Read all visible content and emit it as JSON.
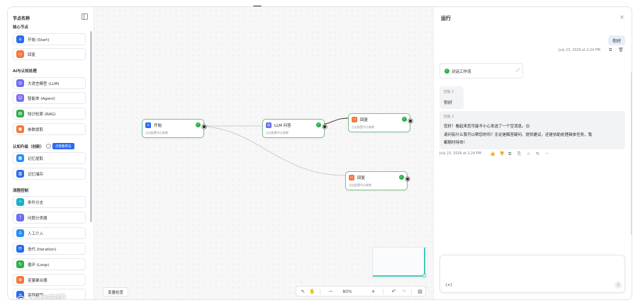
{
  "sidebar": {
    "title": "节点名称",
    "groups": {
      "core": "核心节点",
      "ai": "AI与认知处理",
      "cognitive": "认知升级（创新）",
      "flow": "流程控制"
    },
    "new_tag": "点我看用法",
    "items": [
      {
        "label": "开始 (Start)",
        "icon": "home-icon",
        "color": "#2a6bf2"
      },
      {
        "label": "回复",
        "icon": "reply-icon",
        "color": "#f2793c"
      },
      {
        "label": "大语言模型 (LLM)",
        "icon": "llm-icon",
        "color": "#6b6ef0"
      },
      {
        "label": "智能体 (Agent)",
        "icon": "agent-icon",
        "color": "#7b6cf0"
      },
      {
        "label": "知识检索 (RAG)",
        "icon": "knowledge-icon",
        "color": "#2eae4f"
      },
      {
        "label": "参数提取",
        "icon": "extract-icon",
        "color": "#f2793c"
      },
      {
        "label": "记忆提取",
        "icon": "memory-icon",
        "color": "#2a8cf2"
      },
      {
        "label": "记忆储存",
        "icon": "memory-store-icon",
        "color": "#2a6bf2"
      },
      {
        "label": "条件分支",
        "icon": "branch-icon",
        "color": "#16b3c6"
      },
      {
        "label": "问题分类器",
        "icon": "classifier-icon",
        "color": "#6b6ef0"
      },
      {
        "label": "人工介入",
        "icon": "human-icon",
        "color": "#2a8cf2"
      },
      {
        "label": "迭代 (Iteration)",
        "icon": "iteration-icon",
        "color": "#2a6bf2"
      },
      {
        "label": "循环 (Loop)",
        "icon": "loop-icon",
        "color": "#2eae4f"
      },
      {
        "label": "变量聚合器",
        "icon": "aggregator-icon",
        "color": "#f2793c"
      },
      {
        "label": "变量赋值",
        "icon": "assign-icon",
        "color": "#2a6bf2"
      }
    ]
  },
  "canvas": {
    "nodes": [
      {
        "title": "开始",
        "sub": "点击配置节点参数",
        "icon": "home-icon",
        "color": "#2a6bf2"
      },
      {
        "title": "LLM 问答",
        "sub": "点击配置节点参数",
        "icon": "llm-icon",
        "color": "#6b6ef0"
      },
      {
        "title": "回复",
        "sub": "点击配置节点参数",
        "icon": "reply-icon",
        "color": "#f2793c"
      },
      {
        "title": "回复",
        "sub": "点击配置节点参数",
        "icon": "reply-icon",
        "color": "#f2793c"
      }
    ],
    "var_check": "变量检查",
    "zoom": "80%"
  },
  "run_panel": {
    "title": "运行",
    "user_message": "你好",
    "user_time": "July 23, 2026 at 2:24 PM",
    "workflow_label": "对话工作流",
    "reply1_label": "回复 1",
    "reply1_text": "你好",
    "reply2_label": "回复 2",
    "reply2_line1": "您好！看起来您可能不小心发送了一个空消息。😊",
    "reply2_line2": "请问有什么我可以帮您的吗？无论是解答疑问、提供建议，还是协助处理具体任务，我",
    "reply2_line3": "都随时待命！",
    "bot_time": "July 23, 2026 at 2:24 PM"
  },
  "watermark": "@ 木数暗镜"
}
